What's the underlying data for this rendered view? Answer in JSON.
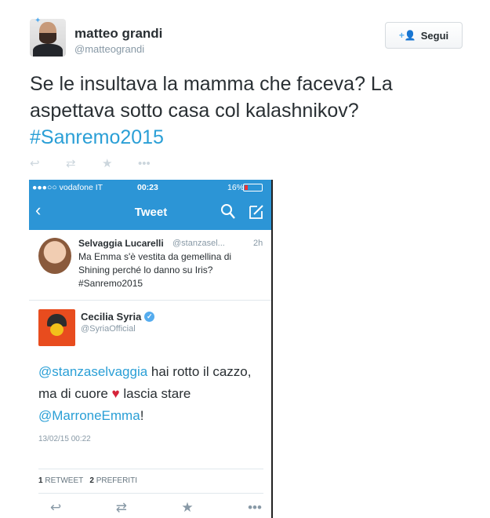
{
  "outer_tweet": {
    "user_name": "matteo grandi",
    "user_handle": "@matteograndi",
    "follow_label": "Segui",
    "text_main": "Se le insultava la mamma che faceva? La aspettava sotto casa col kalashnikov?",
    "hashtag": "#Sanremo2015",
    "actions": [
      "reply-icon",
      "retweet-icon",
      "favorite-icon",
      "more-icon"
    ]
  },
  "phone": {
    "status": {
      "carrier": "●●●○○ vodafone IT",
      "time": "00:23",
      "battery": "16%"
    },
    "nav": {
      "title": "Tweet"
    },
    "quoted_tweet": {
      "name": "Selvaggia Lucarelli",
      "handle": "@stanzasel...",
      "time": "2h",
      "text": "Ma Emma s'è vestita da gemellina di Shining perché lo danno su Iris? #Sanremo2015"
    },
    "main_tweet": {
      "name": "Cecilia Syria",
      "handle": "@SyriaOfficial",
      "mention1": "@stanzaselvaggia",
      "text1": " hai rotto il cazzo, ma di cuore ",
      "text2": " lascia stare ",
      "mention2": "@MarroneEmma",
      "text3": "!",
      "date": "13/02/15 00:22",
      "retweets_count": "1",
      "retweets_label": "RETWEET",
      "favorites_count": "2",
      "favorites_label": "PREFERITI"
    }
  }
}
